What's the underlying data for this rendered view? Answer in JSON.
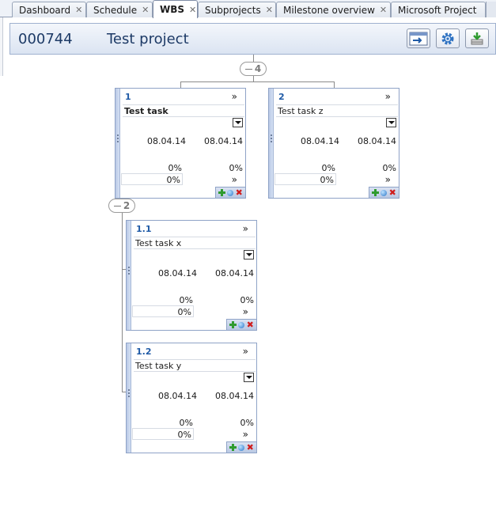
{
  "tabs": [
    {
      "label": "Dashboard",
      "active": false
    },
    {
      "label": "Schedule",
      "active": false
    },
    {
      "label": "WBS",
      "active": true
    },
    {
      "label": "Subprojects",
      "active": false
    },
    {
      "label": "Milestone overview",
      "active": false
    },
    {
      "label": "Microsoft Project",
      "active": false
    }
  ],
  "tab_close_glyph": "✕",
  "header": {
    "project_number": "000744",
    "project_name": "Test project",
    "buttons": [
      {
        "icon": "export-window-icon"
      },
      {
        "icon": "gear-icon"
      },
      {
        "icon": "download-stack-icon"
      }
    ]
  },
  "groups": {
    "root": {
      "count": "4"
    },
    "task1": {
      "count": "2"
    }
  },
  "expand_glyph": "»",
  "tasks": [
    {
      "number": "1",
      "name": "Test task",
      "start": "08.04.14",
      "end": "08.04.14",
      "progress_a": "0%",
      "progress_b": "0%",
      "progress_input": "0%"
    },
    {
      "number": "2",
      "name": "Test task z",
      "start": "08.04.14",
      "end": "08.04.14",
      "progress_a": "0%",
      "progress_b": "0%",
      "progress_input": "0%"
    },
    {
      "number": "1.1",
      "name": "Test task x",
      "start": "08.04.14",
      "end": "08.04.14",
      "progress_a": "0%",
      "progress_b": "0%",
      "progress_input": "0%"
    },
    {
      "number": "1.2",
      "name": "Test task y",
      "start": "08.04.14",
      "end": "08.04.14",
      "progress_a": "0%",
      "progress_b": "0%",
      "progress_input": "0%"
    }
  ],
  "colors": {
    "accent": "#1f5aa6",
    "card_border": "#8fa3c7",
    "header_text": "#1d3a66",
    "delete_red": "#d01d1d",
    "add_green": "#2f9b2f"
  }
}
